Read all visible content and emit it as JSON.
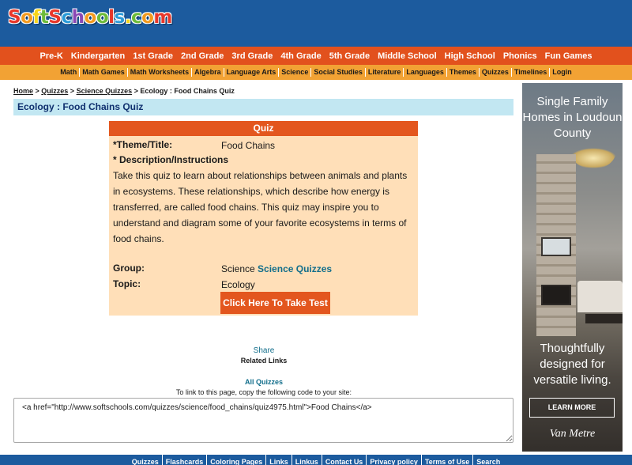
{
  "site": {
    "logo_letters": [
      {
        "ch": "S",
        "color": "#e8372a"
      },
      {
        "ch": "o",
        "color": "#f29a1f"
      },
      {
        "ch": "f",
        "color": "#f7d51b"
      },
      {
        "ch": "t",
        "color": "#6dbb3a"
      },
      {
        "ch": "S",
        "color": "#e8372a"
      },
      {
        "ch": "c",
        "color": "#2a9ad8"
      },
      {
        "ch": "h",
        "color": "#8a48b5"
      },
      {
        "ch": "o",
        "color": "#f29a1f"
      },
      {
        "ch": "o",
        "color": "#6dbb3a"
      },
      {
        "ch": "l",
        "color": "#e8372a"
      },
      {
        "ch": "s",
        "color": "#2a9ad8"
      },
      {
        "ch": ".",
        "color": "#f7d51b"
      },
      {
        "ch": "c",
        "color": "#6dbb3a"
      },
      {
        "ch": "o",
        "color": "#f29a1f"
      },
      {
        "ch": "m",
        "color": "#e8372a"
      }
    ]
  },
  "nav_primary": [
    "Pre-K",
    "Kindergarten",
    "1st Grade",
    "2nd Grade",
    "3rd Grade",
    "4th Grade",
    "5th Grade",
    "Middle School",
    "High School",
    "Phonics",
    "Fun Games"
  ],
  "nav_secondary": [
    "Math",
    "Math Games",
    "Math Worksheets",
    "Algebra",
    "Language Arts",
    "Science",
    "Social Studies",
    "Literature",
    "Languages",
    "Themes",
    "Quizzes",
    "Timelines",
    "Login"
  ],
  "breadcrumb": {
    "home": "Home",
    "sep": " > ",
    "quizzes": "Quizzes",
    "science_quizzes": "Science Quizzes",
    "current": "Ecology : Food Chains Quiz"
  },
  "page_title": "Ecology : Food Chains Quiz",
  "quiz": {
    "header": "Quiz",
    "theme_label": "*Theme/Title:",
    "theme_value": "Food Chains",
    "desc_label": "* Description/Instructions",
    "description": "Take this quiz to learn about relationships between animals and plants in ecosystems. These relationships, which describe how energy is transferred, are called food chains. This quiz may inspire you to understand and diagram some of your favorite ecosystems in terms of food chains.",
    "group_label": "Group:",
    "group_prefix": "Science",
    "group_link": "Science Quizzes",
    "topic_label": "Topic:",
    "topic_value": "Ecology",
    "take_button": "Click Here To Take Test"
  },
  "links": {
    "share": "Share",
    "related": "Related Links",
    "all_quizzes": "All Quizzes",
    "link_info": "To link to this page, copy the following code to your site:",
    "code": "<a href=\"http://www.softschools.com/quizzes/science/food_chains/quiz4975.html\">Food Chains</a>"
  },
  "ad": {
    "headline": "Single Family Homes in Loudoun County",
    "tagline": "Thoughtfully designed for versatile living.",
    "button": "LEARN MORE",
    "brand": "Van Metre"
  },
  "footer": [
    "Quizzes",
    "Flashcards",
    "Coloring Pages",
    "Links",
    "Linkus",
    "Contact Us",
    "Privacy policy",
    "Terms of Use",
    "Search"
  ]
}
